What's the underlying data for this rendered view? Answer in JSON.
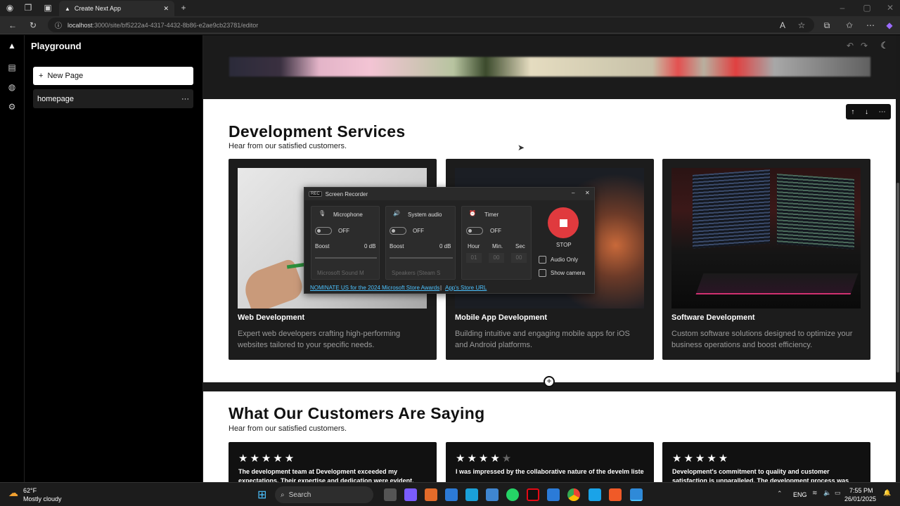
{
  "browser": {
    "tab_title": "Create Next App",
    "url_host": "localhost",
    "url_path": ":3000/site/bf5222a4-4317-4432-8b86-e2ae9cb23781/editor"
  },
  "sidebar": {
    "app_title": "Playground",
    "new_page_label": "New Page",
    "pages": [
      {
        "label": "homepage"
      }
    ]
  },
  "services": {
    "title": "Development Services",
    "subtitle": "Hear from our satisfied customers.",
    "cards": [
      {
        "title": "Web Development",
        "desc": "Expert web developers crafting high-performing websites tailored to your specific needs."
      },
      {
        "title": "Mobile App Development",
        "desc": "Building intuitive and engaging mobile apps for iOS and Android platforms."
      },
      {
        "title": "Software Development",
        "desc": "Custom software solutions designed to optimize your business operations and boost efficiency."
      }
    ]
  },
  "testimonials": {
    "title": "What Our Customers Are Saying",
    "subtitle": "Hear from our satisfied customers.",
    "cards": [
      {
        "stars": "★★★★★",
        "rating": 5,
        "text": "The development team at Development exceeded my expectations. Their expertise and dedication were evident."
      },
      {
        "stars": "★★★★",
        "rating": 4,
        "text": "I was impressed by the collaborative nature of the develm liste"
      },
      {
        "stars": "★★★★★",
        "rating": 5,
        "text": "Development's commitment to quality and customer satisfaction is unparalleled. The development process was"
      }
    ]
  },
  "recorder": {
    "title": "Screen Recorder",
    "badge": "REC",
    "mic_label": "Microphone",
    "sys_label": "System audio",
    "timer_label": "Timer",
    "off": "OFF",
    "boost": "Boost",
    "db": "0 dB",
    "mic_device": "Microsoft Sound M",
    "sys_device": "Speakers (Steam S",
    "hour": "Hour",
    "min": "Min.",
    "sec": "Sec",
    "zero": "00",
    "hour_val": "01",
    "stop": "STOP",
    "audio_only": "Audio Only",
    "show_camera": "Show camera",
    "nominate": "NOMINATE US for the 2024 Microsoft Store Awards",
    "sep": "|",
    "store_url": "App's Store URL"
  },
  "taskbar": {
    "weather_temp": "62°F",
    "weather_desc": "Mostly cloudy",
    "search": "Search",
    "lang": "ENG",
    "time": "7:55 PM",
    "date": "26/01/2025"
  },
  "colors": {
    "stop_red": "#e03a3e",
    "accent_blue": "#4cc2ff"
  }
}
